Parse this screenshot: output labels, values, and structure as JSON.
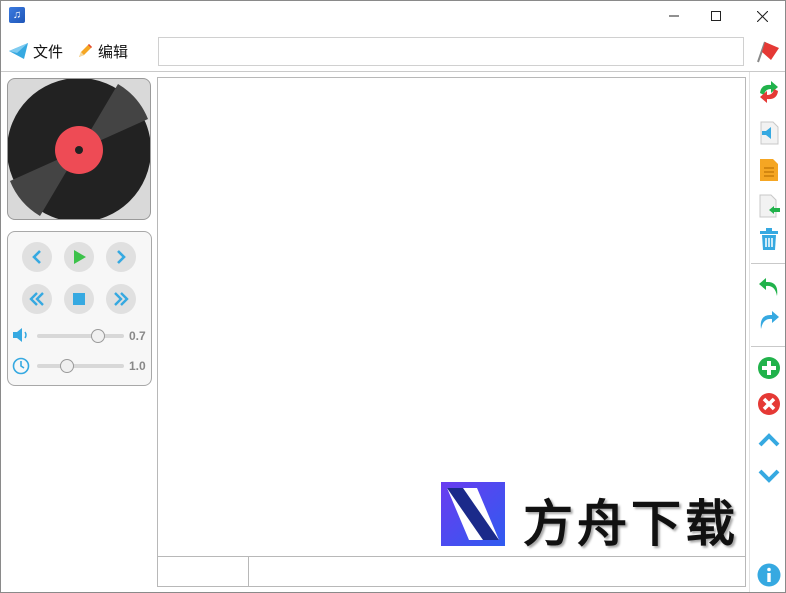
{
  "menu": {
    "file_label": "文件",
    "edit_label": "编辑"
  },
  "search": {
    "value": "",
    "placeholder": ""
  },
  "player": {
    "volume_value": "0.7",
    "volume_level": 0.7,
    "speed_value": "1.0",
    "speed_level": 0.35
  },
  "status": {
    "left": "",
    "right": ""
  },
  "watermark": {
    "text": "方舟下载"
  },
  "colors": {
    "accent_blue": "#36a9e1",
    "play_green": "#3cc24a",
    "add_green": "#21b24b",
    "remove_red": "#e53935",
    "disc_label_red": "#ee4b55"
  },
  "icons": {
    "title": "app-music-icon",
    "file": "paper-plane-icon",
    "edit": "pencil-icon",
    "flag": "flag-icon",
    "toolbar": [
      "refresh-icon",
      "audio-file-icon",
      "document-icon",
      "import-icon",
      "trash-icon",
      "undo-icon",
      "redo-icon",
      "add-icon",
      "remove-icon",
      "move-up-icon",
      "move-down-icon",
      "info-icon"
    ]
  }
}
